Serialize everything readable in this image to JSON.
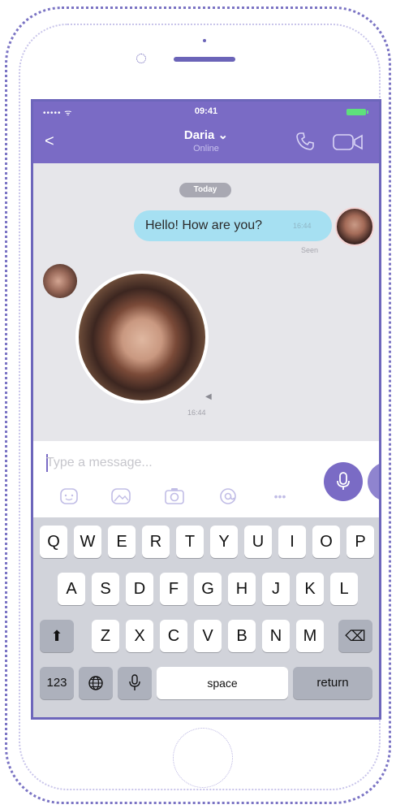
{
  "status_bar": {
    "signal": "••••• ᯤ",
    "time": "09:41"
  },
  "header": {
    "back_icon": "back-arrow-icon",
    "name": "Daria ⌄",
    "status": "Online"
  },
  "chat": {
    "date": "Today",
    "outgoing": {
      "text": "Hello! How are you?",
      "time": "16:44",
      "status": "Seen"
    },
    "video_message": {
      "time": "16:44"
    }
  },
  "composer": {
    "placeholder": "Type a message...",
    "more_label": "•••"
  },
  "keyboard": {
    "row1": [
      "Q",
      "W",
      "E",
      "R",
      "T",
      "Y",
      "U",
      "I",
      "O",
      "P"
    ],
    "row2": [
      "A",
      "S",
      "D",
      "F",
      "G",
      "H",
      "J",
      "K",
      "L"
    ],
    "row3": [
      "Z",
      "X",
      "C",
      "V",
      "B",
      "N",
      "M"
    ],
    "shift": "⬆",
    "delete": "⌫",
    "numbers": "123",
    "space": "space",
    "return": "return"
  },
  "colors": {
    "accent": "#7a6bc5",
    "bubble": "#a6e0f2",
    "frame": "#6d66bb"
  }
}
